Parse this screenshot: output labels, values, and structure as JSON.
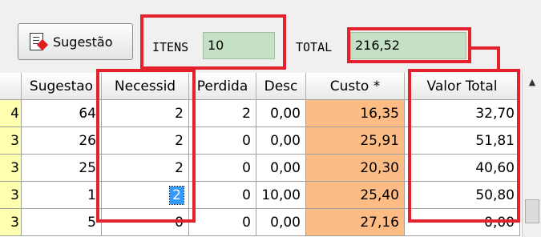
{
  "toolbar": {
    "suggest_button": "Sugestão",
    "items_label": "ITENS",
    "items_value": "10",
    "total_label": "TOTAL",
    "total_value": "216,52"
  },
  "grid": {
    "columns": [
      "",
      "Sugestao",
      "Necessid",
      "Perdida",
      "Desc",
      "Custo *",
      "Valor Total"
    ],
    "rows": [
      [
        "4",
        "64",
        "2",
        "2",
        "0,00",
        "16,35",
        "32,70"
      ],
      [
        "3",
        "26",
        "2",
        "0",
        "0,00",
        "25,91",
        "51,81"
      ],
      [
        "3",
        "25",
        "2",
        "0",
        "0,00",
        "20,30",
        "40,60"
      ],
      [
        "3",
        "1",
        "2",
        "0",
        "10,00",
        "25,40",
        "50,80"
      ],
      [
        "3",
        "5",
        "0",
        "0",
        "0,00",
        "27,16",
        "0,00"
      ]
    ]
  },
  "colors": {
    "highlight": "#e4222e",
    "field_bg": "#c5e1c5",
    "cost_bg": "#fcbc84",
    "first_col_bg": "#ffffb0",
    "selection": "#3399ff"
  },
  "icons": {
    "suggest": "document-suggest-icon",
    "scroll_up": "triangle-up-icon"
  }
}
